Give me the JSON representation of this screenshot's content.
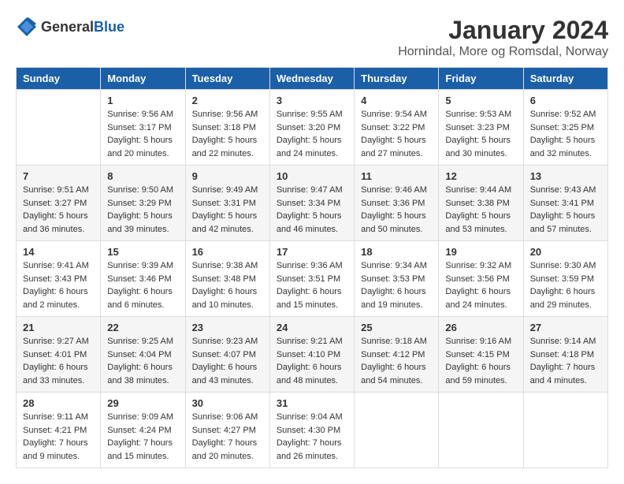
{
  "header": {
    "logo_general": "General",
    "logo_blue": "Blue",
    "title": "January 2024",
    "location": "Hornindal, More og Romsdal, Norway"
  },
  "weekdays": [
    "Sunday",
    "Monday",
    "Tuesday",
    "Wednesday",
    "Thursday",
    "Friday",
    "Saturday"
  ],
  "weeks": [
    [
      {
        "day": "",
        "info": ""
      },
      {
        "day": "1",
        "info": "Sunrise: 9:56 AM\nSunset: 3:17 PM\nDaylight: 5 hours\nand 20 minutes."
      },
      {
        "day": "2",
        "info": "Sunrise: 9:56 AM\nSunset: 3:18 PM\nDaylight: 5 hours\nand 22 minutes."
      },
      {
        "day": "3",
        "info": "Sunrise: 9:55 AM\nSunset: 3:20 PM\nDaylight: 5 hours\nand 24 minutes."
      },
      {
        "day": "4",
        "info": "Sunrise: 9:54 AM\nSunset: 3:22 PM\nDaylight: 5 hours\nand 27 minutes."
      },
      {
        "day": "5",
        "info": "Sunrise: 9:53 AM\nSunset: 3:23 PM\nDaylight: 5 hours\nand 30 minutes."
      },
      {
        "day": "6",
        "info": "Sunrise: 9:52 AM\nSunset: 3:25 PM\nDaylight: 5 hours\nand 32 minutes."
      }
    ],
    [
      {
        "day": "7",
        "info": "Sunrise: 9:51 AM\nSunset: 3:27 PM\nDaylight: 5 hours\nand 36 minutes."
      },
      {
        "day": "8",
        "info": "Sunrise: 9:50 AM\nSunset: 3:29 PM\nDaylight: 5 hours\nand 39 minutes."
      },
      {
        "day": "9",
        "info": "Sunrise: 9:49 AM\nSunset: 3:31 PM\nDaylight: 5 hours\nand 42 minutes."
      },
      {
        "day": "10",
        "info": "Sunrise: 9:47 AM\nSunset: 3:34 PM\nDaylight: 5 hours\nand 46 minutes."
      },
      {
        "day": "11",
        "info": "Sunrise: 9:46 AM\nSunset: 3:36 PM\nDaylight: 5 hours\nand 50 minutes."
      },
      {
        "day": "12",
        "info": "Sunrise: 9:44 AM\nSunset: 3:38 PM\nDaylight: 5 hours\nand 53 minutes."
      },
      {
        "day": "13",
        "info": "Sunrise: 9:43 AM\nSunset: 3:41 PM\nDaylight: 5 hours\nand 57 minutes."
      }
    ],
    [
      {
        "day": "14",
        "info": "Sunrise: 9:41 AM\nSunset: 3:43 PM\nDaylight: 6 hours\nand 2 minutes."
      },
      {
        "day": "15",
        "info": "Sunrise: 9:39 AM\nSunset: 3:46 PM\nDaylight: 6 hours\nand 6 minutes."
      },
      {
        "day": "16",
        "info": "Sunrise: 9:38 AM\nSunset: 3:48 PM\nDaylight: 6 hours\nand 10 minutes."
      },
      {
        "day": "17",
        "info": "Sunrise: 9:36 AM\nSunset: 3:51 PM\nDaylight: 6 hours\nand 15 minutes."
      },
      {
        "day": "18",
        "info": "Sunrise: 9:34 AM\nSunset: 3:53 PM\nDaylight: 6 hours\nand 19 minutes."
      },
      {
        "day": "19",
        "info": "Sunrise: 9:32 AM\nSunset: 3:56 PM\nDaylight: 6 hours\nand 24 minutes."
      },
      {
        "day": "20",
        "info": "Sunrise: 9:30 AM\nSunset: 3:59 PM\nDaylight: 6 hours\nand 29 minutes."
      }
    ],
    [
      {
        "day": "21",
        "info": "Sunrise: 9:27 AM\nSunset: 4:01 PM\nDaylight: 6 hours\nand 33 minutes."
      },
      {
        "day": "22",
        "info": "Sunrise: 9:25 AM\nSunset: 4:04 PM\nDaylight: 6 hours\nand 38 minutes."
      },
      {
        "day": "23",
        "info": "Sunrise: 9:23 AM\nSunset: 4:07 PM\nDaylight: 6 hours\nand 43 minutes."
      },
      {
        "day": "24",
        "info": "Sunrise: 9:21 AM\nSunset: 4:10 PM\nDaylight: 6 hours\nand 48 minutes."
      },
      {
        "day": "25",
        "info": "Sunrise: 9:18 AM\nSunset: 4:12 PM\nDaylight: 6 hours\nand 54 minutes."
      },
      {
        "day": "26",
        "info": "Sunrise: 9:16 AM\nSunset: 4:15 PM\nDaylight: 6 hours\nand 59 minutes."
      },
      {
        "day": "27",
        "info": "Sunrise: 9:14 AM\nSunset: 4:18 PM\nDaylight: 7 hours\nand 4 minutes."
      }
    ],
    [
      {
        "day": "28",
        "info": "Sunrise: 9:11 AM\nSunset: 4:21 PM\nDaylight: 7 hours\nand 9 minutes."
      },
      {
        "day": "29",
        "info": "Sunrise: 9:09 AM\nSunset: 4:24 PM\nDaylight: 7 hours\nand 15 minutes."
      },
      {
        "day": "30",
        "info": "Sunrise: 9:06 AM\nSunset: 4:27 PM\nDaylight: 7 hours\nand 20 minutes."
      },
      {
        "day": "31",
        "info": "Sunrise: 9:04 AM\nSunset: 4:30 PM\nDaylight: 7 hours\nand 26 minutes."
      },
      {
        "day": "",
        "info": ""
      },
      {
        "day": "",
        "info": ""
      },
      {
        "day": "",
        "info": ""
      }
    ]
  ]
}
